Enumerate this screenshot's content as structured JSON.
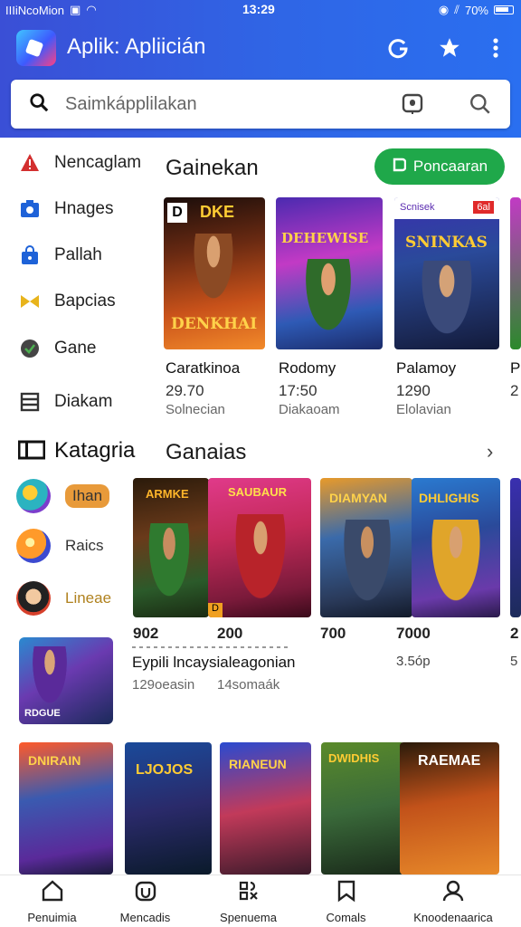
{
  "status_bar": {
    "carrier": "IIIiNcoMion",
    "time": "13:29",
    "battery": "70%"
  },
  "header": {
    "title": "Aplik: Apliicián",
    "icons": [
      "refresh-icon",
      "star-icon",
      "more-vert-icon"
    ]
  },
  "search": {
    "placeholder": "Saimkápplilakan"
  },
  "sidebar": {
    "items": [
      {
        "label": "Nencaglam",
        "icon": "alert-icon"
      },
      {
        "label": "Hnages",
        "icon": "image-icon"
      },
      {
        "label": "Pallah",
        "icon": "bag-icon"
      },
      {
        "label": "Bapcias",
        "icon": "bowtie-icon"
      },
      {
        "label": "Gane",
        "icon": "shield-icon"
      },
      {
        "label": "Diakam",
        "icon": "list-icon"
      }
    ],
    "category_heading": "Katagria",
    "categories": [
      {
        "label": "Ihan"
      },
      {
        "label": "Raics"
      },
      {
        "label": "Lineae"
      }
    ]
  },
  "section1": {
    "title": "Gainekan",
    "button": "Poncaaran",
    "cards": [
      {
        "art_title": "DKE",
        "badge": "D",
        "name": "Caratkinoa",
        "value": "29.70",
        "sub": "Solnecian",
        "banner": "DENKHAI"
      },
      {
        "art_title": "DEHEWISE",
        "name": "Rodomy",
        "value": "17:50",
        "sub": "Diakaoam"
      },
      {
        "art_title": "SNINKAS",
        "badge": "Scnisek",
        "badge2": "6al",
        "name": "Palamoy",
        "value": "1290",
        "sub": "Elolavian"
      },
      {
        "name": "P",
        "value": "2"
      }
    ]
  },
  "section2": {
    "title": "Ganaias",
    "cards": [
      {
        "art_title": "ARMKE",
        "num": "902",
        "badge": "D"
      },
      {
        "art_title": "SAUBAUR",
        "num": "200"
      },
      {
        "art_title": "DIAMYAN",
        "num": "700"
      },
      {
        "art_title": "DHLIGHIS",
        "num": "7000"
      },
      {
        "num": "2"
      }
    ],
    "caption": "Eypili lncaysialeagonian",
    "left_sub": "129oeasin",
    "mid_sub": "14somaák",
    "price": "3.5óp",
    "edge": "5"
  },
  "featured": {
    "banner": "RDGUE"
  },
  "bottom_row": [
    {
      "art_title": "DNIRAIN"
    },
    {
      "art_title": "LJOJOS"
    },
    {
      "art_title": "RIANEUN"
    },
    {
      "art_title": "DWIDHIS"
    },
    {
      "art_title": "RAEMAE"
    }
  ],
  "bottom_nav": [
    {
      "label": "Penuimia",
      "icon": "home-icon"
    },
    {
      "label": "Mencadis",
      "icon": "controller-icon"
    },
    {
      "label": "Spenuema",
      "icon": "apps-icon"
    },
    {
      "label": "Comals",
      "icon": "bookmark-icon"
    },
    {
      "label": "Knoodenaarica",
      "icon": "profile-icon"
    }
  ],
  "colors": {
    "header_blue": "#3a5de0",
    "accent_green": "#1fa84a",
    "pill_orange": "#e89a3a"
  }
}
